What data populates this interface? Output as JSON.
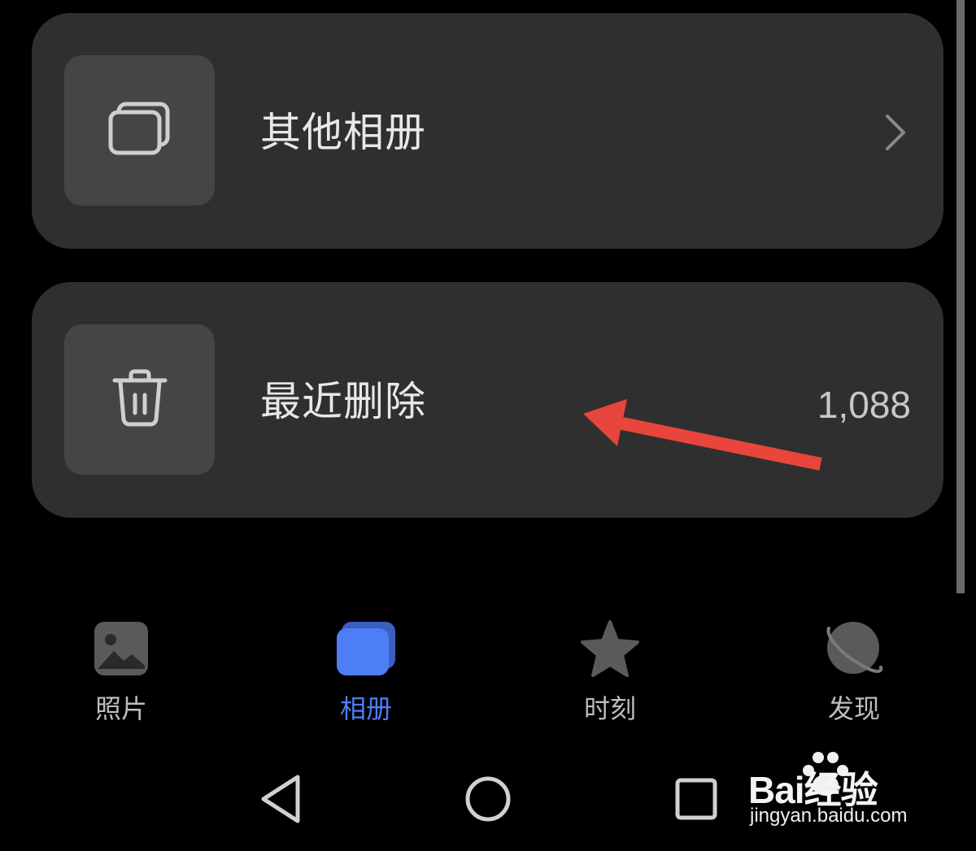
{
  "albums": [
    {
      "title": "其他相册",
      "icon": "albums-stack-icon",
      "trailing_icon": "chevron-right-icon"
    },
    {
      "title": "最近删除",
      "icon": "trash-icon",
      "count": "1,088"
    }
  ],
  "annotation": {
    "icon": "red-arrow-icon",
    "color": "#e8453c"
  },
  "bottom_nav": {
    "items": [
      {
        "label": "照片",
        "icon": "photo-icon",
        "active": false
      },
      {
        "label": "相册",
        "icon": "album-icon",
        "active": true
      },
      {
        "label": "时刻",
        "icon": "star-icon",
        "active": false
      },
      {
        "label": "发现",
        "icon": "planet-icon",
        "active": false
      }
    ],
    "active_color": "#4d7ef5"
  },
  "system_nav": {
    "back": "back-triangle-icon",
    "home": "home-circle-icon",
    "recents": "recents-square-icon"
  },
  "watermark": {
    "brand": "Bai经验",
    "url": "jingyan.baidu.com"
  }
}
